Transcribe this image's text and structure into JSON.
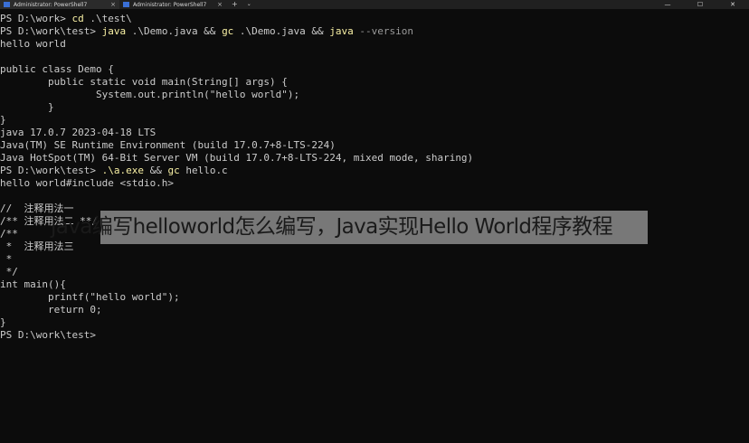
{
  "tabs": [
    {
      "title": "Administrator: PowerShell7",
      "close": "×"
    },
    {
      "title": "Administrator: PowerShell7",
      "close": "×"
    }
  ],
  "new_tab_label": "+",
  "dropdown_label": "⌄",
  "window_controls": {
    "minimize": "—",
    "maximize": "☐",
    "close": "✕"
  },
  "terminal": {
    "l1": {
      "prompt": "PS D:\\work> ",
      "cmd": "cd",
      "arg": " .\\test\\"
    },
    "l2": {
      "prompt": "PS D:\\work\\test> ",
      "c1": "java",
      "a1": " .\\Demo.java && ",
      "c2": "gc",
      "a2": " .\\Demo.java && ",
      "c3": "java",
      "p3": " --version"
    },
    "l3": "hello world",
    "l4": "",
    "l5": "public class Demo {",
    "l6": "        public static void main(String[] args) {",
    "l7": "                System.out.println(\"hello world\");",
    "l8": "        }",
    "l9": "}",
    "l10": "java 17.0.7 2023-04-18 LTS",
    "l11": "Java(TM) SE Runtime Environment (build 17.0.7+8-LTS-224)",
    "l12": "Java HotSpot(TM) 64-Bit Server VM (build 17.0.7+8-LTS-224, mixed mode, sharing)",
    "l13": {
      "prompt": "PS D:\\work\\test> ",
      "c1": ".\\a.exe",
      "a1": " && ",
      "c2": "gc",
      "a2": " hello.c"
    },
    "l14": "hello world#include <stdio.h>",
    "l15": "",
    "l16": "//  注释用法一",
    "l17": "/** 注释用法二 **/",
    "l18": "/**",
    "l19": " *  注释用法三",
    "l20": " *",
    "l21": " */",
    "l22": "int main(){",
    "l23": "        printf(\"hello world\");",
    "l24": "        return 0;",
    "l25": "}",
    "l26": "PS D:\\work\\test> "
  },
  "caption": "java编写helloworld怎么编写，Java实现Hello World程序教程",
  "colors": {
    "background": "#0c0c0c",
    "text": "#cccccc",
    "command": "#f9f1a5",
    "parameter": "#9a9a9a",
    "overlay": "#d2d2d2"
  }
}
